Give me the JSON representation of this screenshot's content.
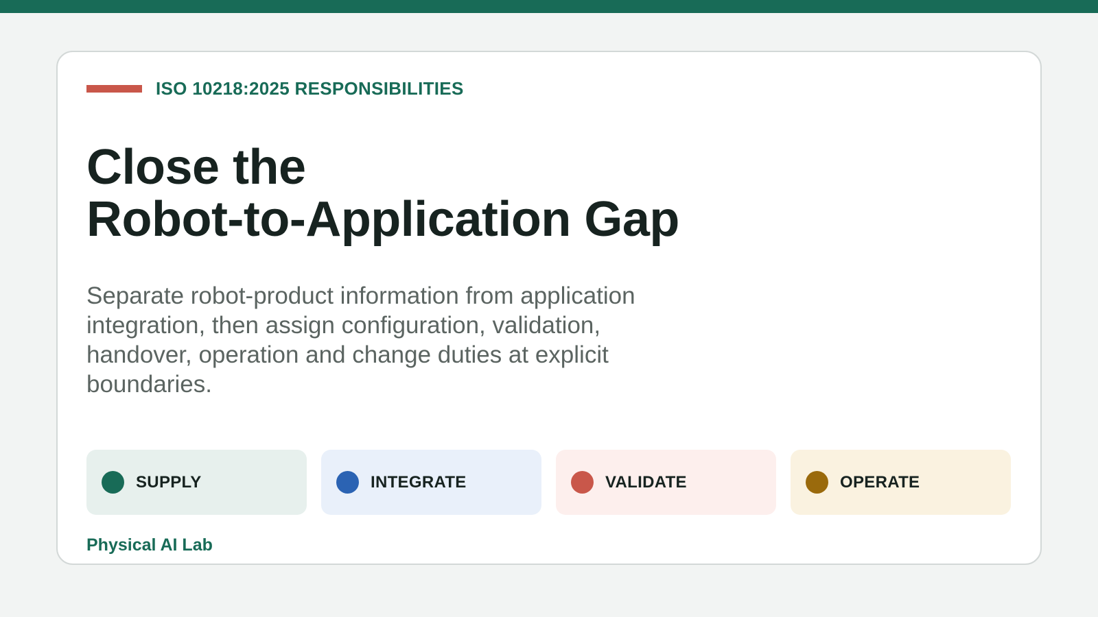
{
  "eyebrow": "ISO 10218:2025 RESPONSIBILITIES",
  "title": {
    "line1": "Close the",
    "line2": "Robot-to-Application Gap"
  },
  "description": "Separate robot-product information from application integration, then assign configuration, validation, handover, operation and change duties at explicit boundaries.",
  "stages": [
    {
      "label": "SUPPLY",
      "dot_color": "#186b57",
      "bg_color": "#e7f0ed"
    },
    {
      "label": "INTEGRATE",
      "dot_color": "#2b63b3",
      "bg_color": "#e9f0fa"
    },
    {
      "label": "VALIDATE",
      "dot_color": "#c9574a",
      "bg_color": "#fdefed"
    },
    {
      "label": "OPERATE",
      "dot_color": "#9a6a0c",
      "bg_color": "#faf2e0"
    }
  ],
  "footer": "Physical AI Lab",
  "colors": {
    "accent": "#186b57",
    "eyebrow_bar": "#c9574a",
    "title": "#172320",
    "body_text": "#5b6461"
  }
}
